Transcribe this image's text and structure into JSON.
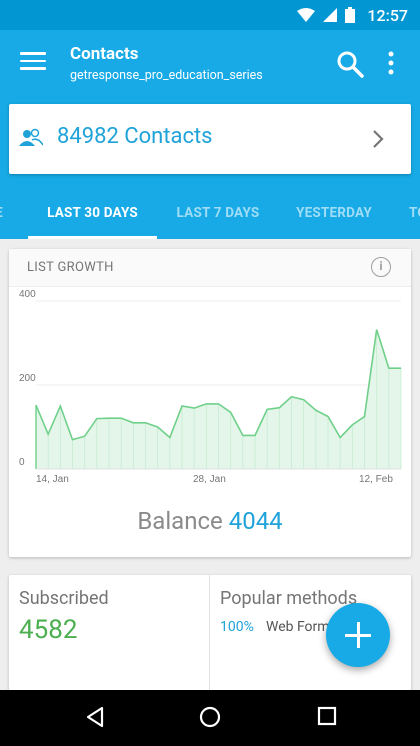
{
  "status_bar": {
    "time": "12:57"
  },
  "app_bar": {
    "title": "Contacts",
    "subtitle": "getresponse_pro_education_series"
  },
  "contacts_card": {
    "label": "84982 Contacts"
  },
  "tabs": [
    {
      "label": "E"
    },
    {
      "label": "LAST 30 DAYS",
      "active": true
    },
    {
      "label": "LAST 7 DAYS"
    },
    {
      "label": "YESTERDAY"
    },
    {
      "label": "TO"
    }
  ],
  "list_growth": {
    "title": "LIST GROWTH",
    "balance_label": "Balance",
    "balance_value": "4044"
  },
  "chart_data": {
    "type": "area",
    "ylim": [
      0,
      400
    ],
    "yticks": [
      "0",
      "200",
      "400"
    ],
    "x_labels": [
      "14, Jan",
      "28, Jan",
      "12, Feb"
    ],
    "color": "#6fd08a",
    "values": [
      152,
      83,
      150,
      70,
      78,
      120,
      121,
      121,
      110,
      110,
      100,
      75,
      150,
      145,
      155,
      155,
      135,
      80,
      80,
      142,
      146,
      172,
      165,
      140,
      125,
      75,
      105,
      125,
      332,
      240,
      240
    ]
  },
  "subscribed": {
    "label": "Subscribed",
    "value": "4582"
  },
  "popular_methods": {
    "label": "Popular methods",
    "percent": "100%",
    "method": "Web Form"
  },
  "icons": {
    "menu": "menu-icon",
    "search": "search-icon",
    "more": "more-vert-icon",
    "contacts": "people-icon",
    "chevron": "chevron-right-icon",
    "info": "info-icon",
    "fab": "add-icon"
  }
}
